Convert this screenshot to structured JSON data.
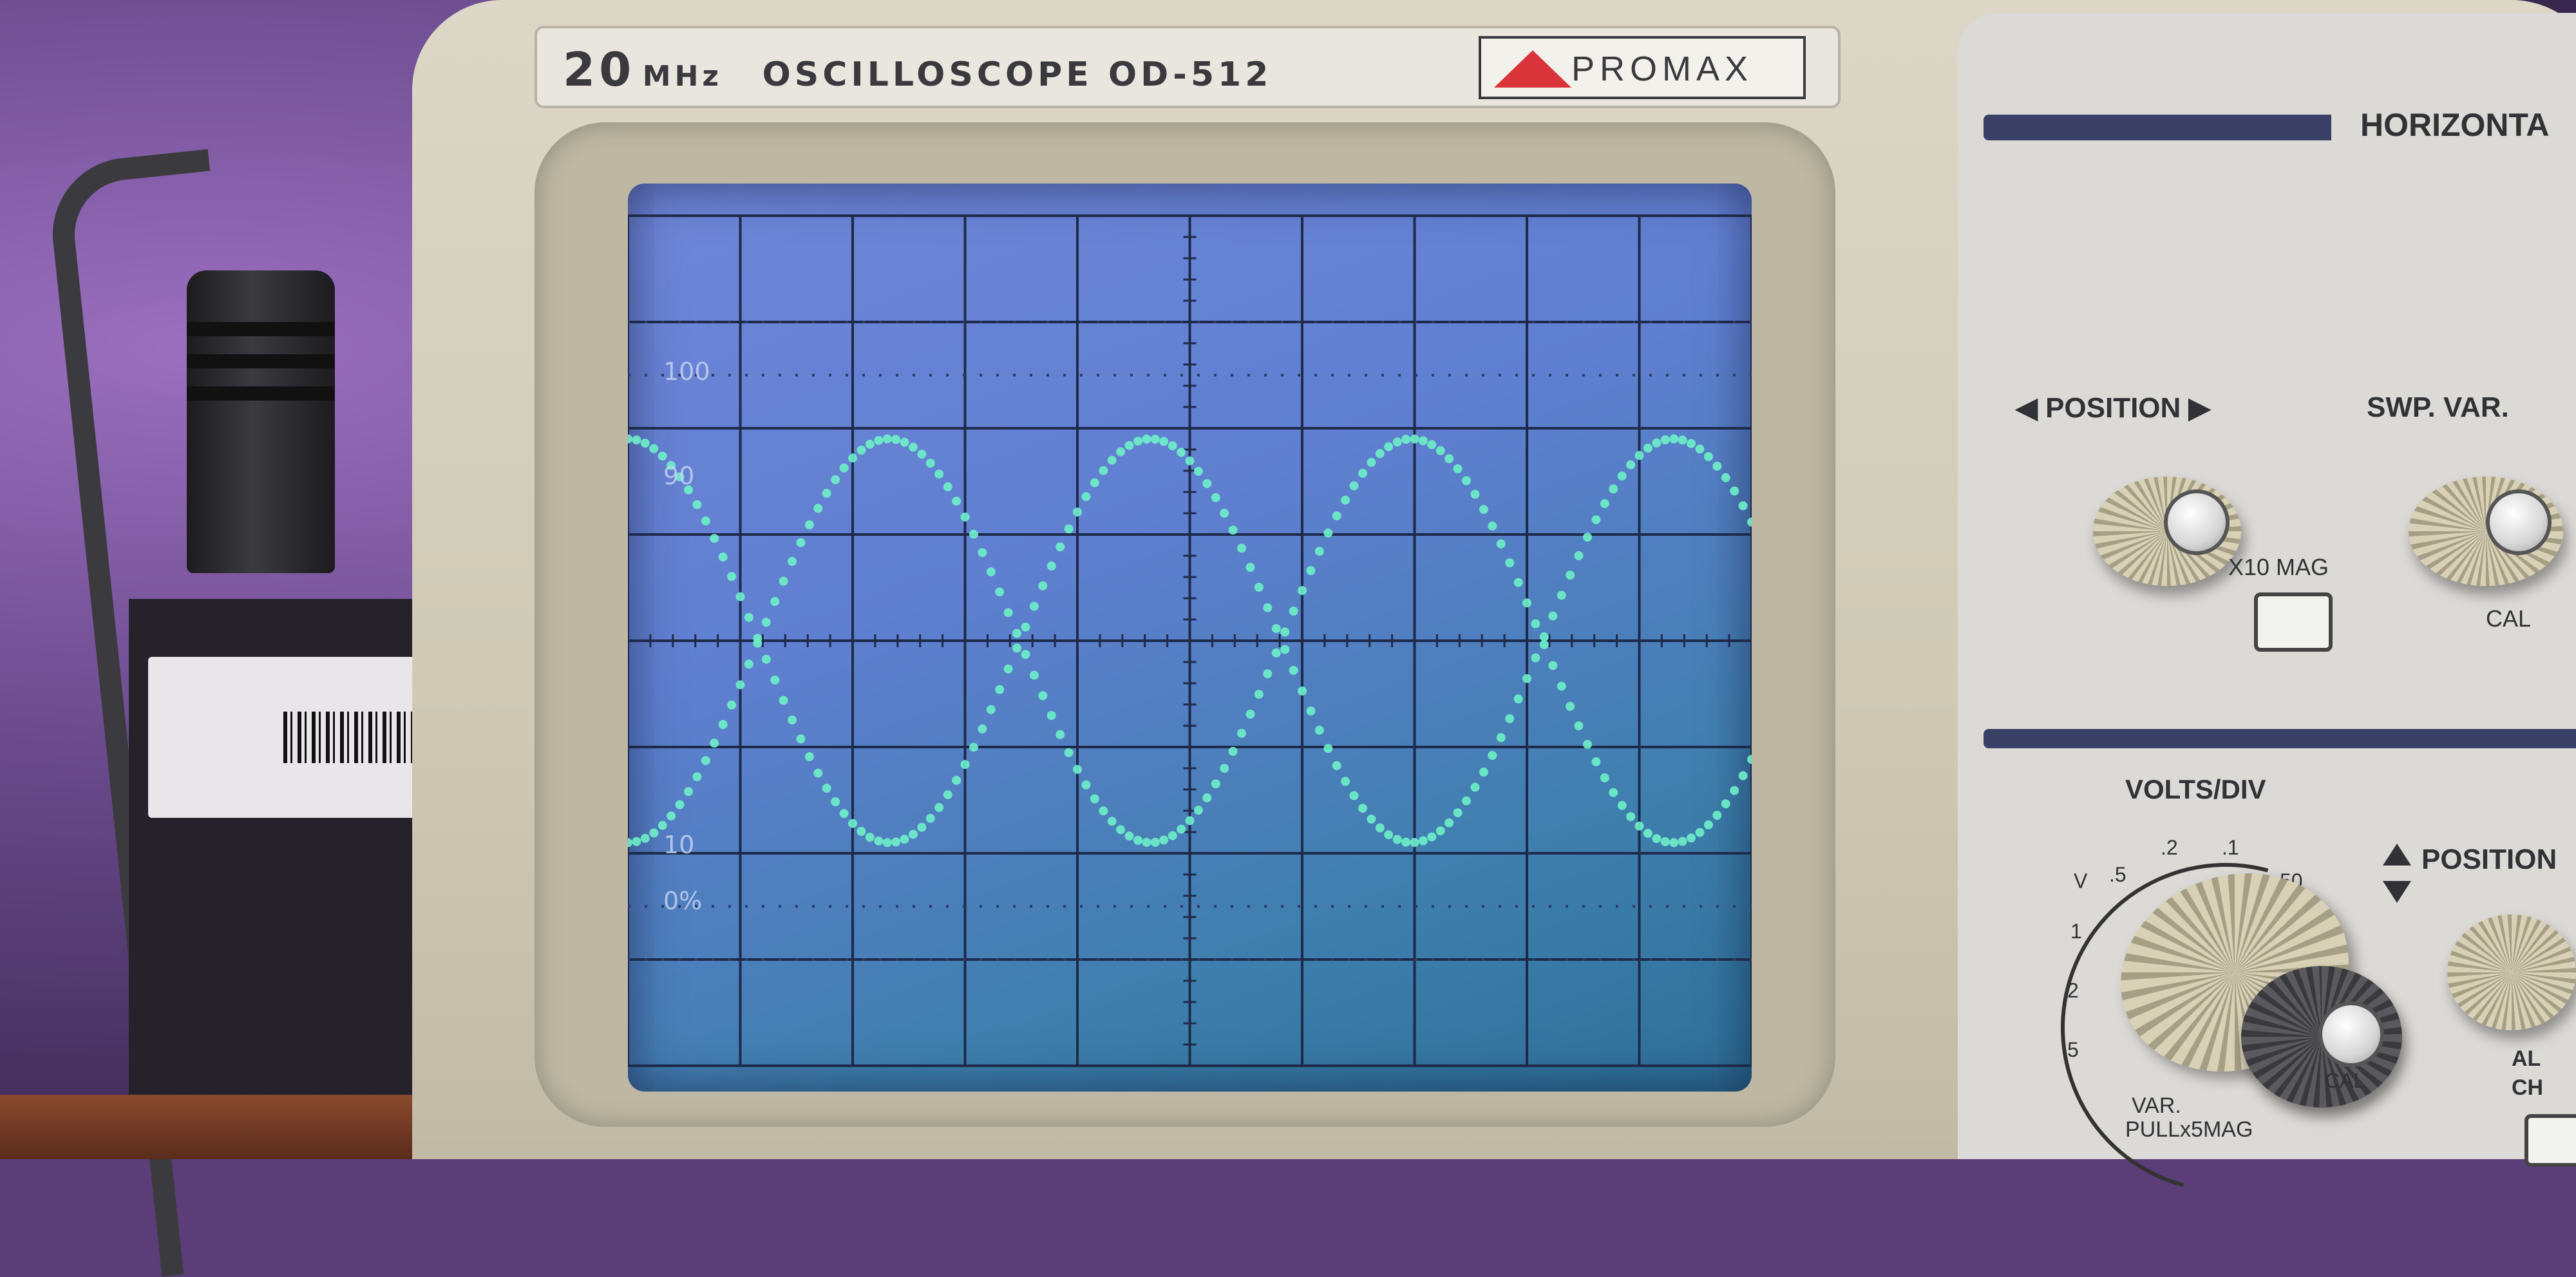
{
  "header": {
    "freq_value": "20",
    "freq_unit": "MHz",
    "model": "OSCILLOSCOPE OD-512",
    "brand": "PROMAX"
  },
  "screen": {
    "markers": {
      "m100": "100",
      "m90": "90",
      "m10": "10",
      "m0": "0%"
    }
  },
  "panel": {
    "horizontal": "HORIZONTA",
    "position": "◀ POSITION ▶",
    "swp_var": "SWP. VAR.",
    "x10_mag": "X10 MAG",
    "cal": "CAL",
    "volts_div": "VOLTS/DIV",
    "v_position": "POSITION",
    "dial": {
      "v": "V",
      "d5": ".5",
      "d2": ".2",
      "d1": ".1",
      "d50": "50",
      "n1": "1",
      "n2": "2",
      "n5": "5",
      "cal2": "CAL"
    },
    "var": "VAR.",
    "pull": "PULLx5MAG",
    "alt": "AL",
    "ch": "CH"
  },
  "waveforms": {
    "trace_color": "#6ef0c8",
    "divisions_x": 10,
    "divisions_y": 8,
    "series": [
      {
        "amplitude_div": 1.9,
        "offset_div": 0.0,
        "cycles": 2.15,
        "phase_deg": 90
      },
      {
        "amplitude_div": 1.9,
        "offset_div": 0.0,
        "cycles": 2.15,
        "phase_deg": -90
      }
    ]
  }
}
